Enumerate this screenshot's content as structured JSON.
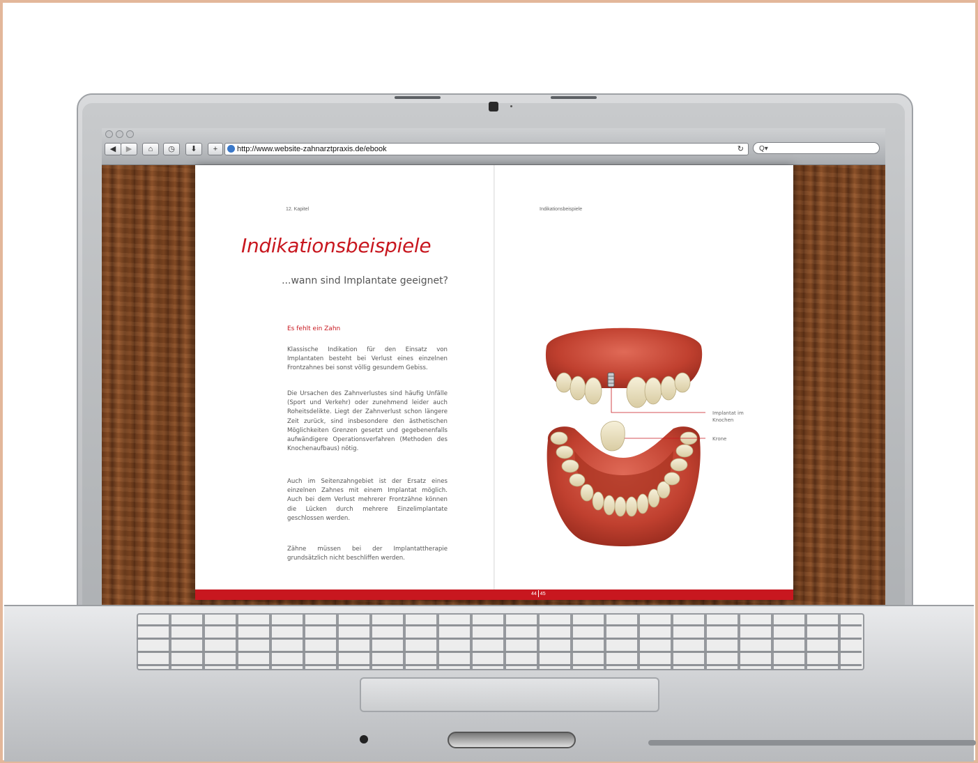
{
  "browser": {
    "url": "http://www.website-zahnarztpraxis.de/ebook",
    "reload_icon": "reload-icon",
    "search_placeholder": "Q▾",
    "buttons": {
      "back": "◀",
      "forward": "▶",
      "home": "⌂",
      "history": "◷",
      "downloads": "⬇",
      "add": "+"
    }
  },
  "book": {
    "left_header": "12. Kapitel",
    "right_header": "Indikationsbeispiele",
    "title": "Indikationsbeispiele",
    "subtitle": "...wann sind Implantate geeignet?",
    "section_heading": "Es fehlt ein Zahn",
    "paragraphs": [
      "Klassische Indikation für den Einsatz von Implantaten besteht bei Verlust eines einzelnen Frontzahnes bei sonst völlig gesundem Gebiss.",
      "Die Ursachen des Zahnverlustes sind häufig Unfälle (Sport und Verkehr) oder zunehmend leider auch Roheitsdelikte. Liegt der Zahnverlust schon längere Zeit zurück, sind insbesondere den ästhetischen Möglichkeiten Grenzen gesetzt und gegebenenfalls aufwändigere Operationsverfahren (Methoden des Knochenaufbaus) nötig.",
      "Auch im Seitenzahngebiet ist der Ersatz eines einzelnen Zahnes mit einem Implantat möglich. Auch bei dem Verlust mehrerer Frontzähne können die Lücken durch mehrere Einzelimplantate geschlossen werden.",
      "Zähne müssen bei der Implantattherapie grundsätzlich nicht beschliffen werden."
    ],
    "callouts": {
      "implant_line1": "Implantat im",
      "implant_line2": "Knochen",
      "crown": "Krone"
    },
    "page_left": "44",
    "page_right": "45"
  },
  "colors": {
    "accent_red": "#c8171f",
    "wood": "#7e4621",
    "gum": "#c84a3a",
    "tooth": "#ece3c4"
  }
}
